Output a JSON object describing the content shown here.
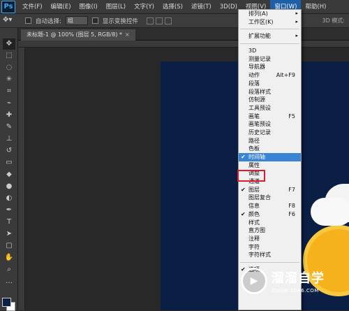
{
  "app": {
    "logo": "Ps"
  },
  "menubar": {
    "items": [
      {
        "label": "文件(F)"
      },
      {
        "label": "编辑(E)"
      },
      {
        "label": "图像(I)"
      },
      {
        "label": "图层(L)"
      },
      {
        "label": "文字(Y)"
      },
      {
        "label": "选择(S)"
      },
      {
        "label": "滤镜(T)"
      },
      {
        "label": "3D(D)"
      },
      {
        "label": "视图(V)"
      },
      {
        "label": "窗口(W)"
      },
      {
        "label": "帮助(H)"
      }
    ],
    "active_index": 9
  },
  "options": {
    "auto_select_label": "自动选择:",
    "auto_select_value": "组",
    "show_transform_label": "显示变换控件",
    "mode_3d": "3D 模式:"
  },
  "document": {
    "tab_title": "未标题-1 @ 100% (图层 5, RGB/8) *",
    "close": "×"
  },
  "window_menu": {
    "items": [
      {
        "label": "排列(A)",
        "arrow": "▸"
      },
      {
        "label": "工作区(K)",
        "arrow": "▸"
      },
      {
        "sep": true
      },
      {
        "label": "扩展功能",
        "arrow": "▸"
      },
      {
        "sep": true
      },
      {
        "label": "3D"
      },
      {
        "label": "测量记录"
      },
      {
        "label": "导航器"
      },
      {
        "label": "动作",
        "shortcut": "Alt+F9"
      },
      {
        "label": "段落"
      },
      {
        "label": "段落样式"
      },
      {
        "label": "仿制源"
      },
      {
        "label": "工具预设"
      },
      {
        "label": "画笔",
        "shortcut": "F5"
      },
      {
        "label": "画笔预设"
      },
      {
        "label": "历史记录"
      },
      {
        "label": "路径"
      },
      {
        "label": "色板"
      },
      {
        "label": "时间轴",
        "checked": true,
        "highlighted": true
      },
      {
        "label": "属性"
      },
      {
        "label": "调整"
      },
      {
        "label": "通道"
      },
      {
        "label": "图层",
        "checked": true,
        "shortcut": "F7"
      },
      {
        "label": "图层复合"
      },
      {
        "label": "信息",
        "shortcut": "F8"
      },
      {
        "label": "颜色",
        "checked": true,
        "shortcut": "F6"
      },
      {
        "label": "样式"
      },
      {
        "label": "直方图"
      },
      {
        "label": "注释"
      },
      {
        "label": "字符"
      },
      {
        "label": "字符样式"
      },
      {
        "sep": true
      },
      {
        "label": "选项",
        "checked": true
      }
    ]
  },
  "watermark": {
    "title": "溜溜自学",
    "url": "ZIXUE.3D66.COM"
  },
  "colors": {
    "accent": "#1f5fa8",
    "canvas": "#0b1f45",
    "highlight": "#3a84d6",
    "annotation": "#e01b2e"
  }
}
